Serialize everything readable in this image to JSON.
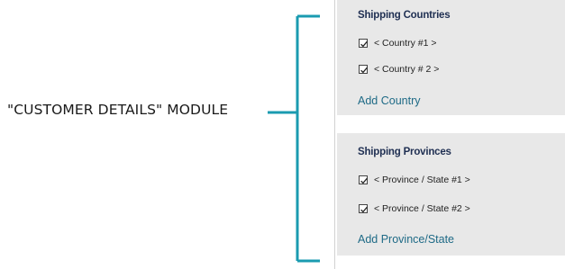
{
  "callout": {
    "label": "\"CUSTOMER DETAILS\" MODULE",
    "bracket_color": "#1a9bb0"
  },
  "countries_panel": {
    "title": "Shipping Countries",
    "items": [
      {
        "label": "< Country #1 >",
        "checked": true
      },
      {
        "label": "< Country # 2 >",
        "checked": true
      }
    ],
    "add_link": "Add Country"
  },
  "provinces_panel": {
    "title": "Shipping Provinces",
    "items": [
      {
        "label": "< Province / State #1 >",
        "checked": true
      },
      {
        "label": "< Province / State #2 >",
        "checked": true
      }
    ],
    "add_link": "Add Province/State"
  },
  "colors": {
    "panel_bg": "#e8e8e8",
    "title": "#1f2f52",
    "link": "#1e6a86",
    "bracket": "#1a9bb0"
  }
}
